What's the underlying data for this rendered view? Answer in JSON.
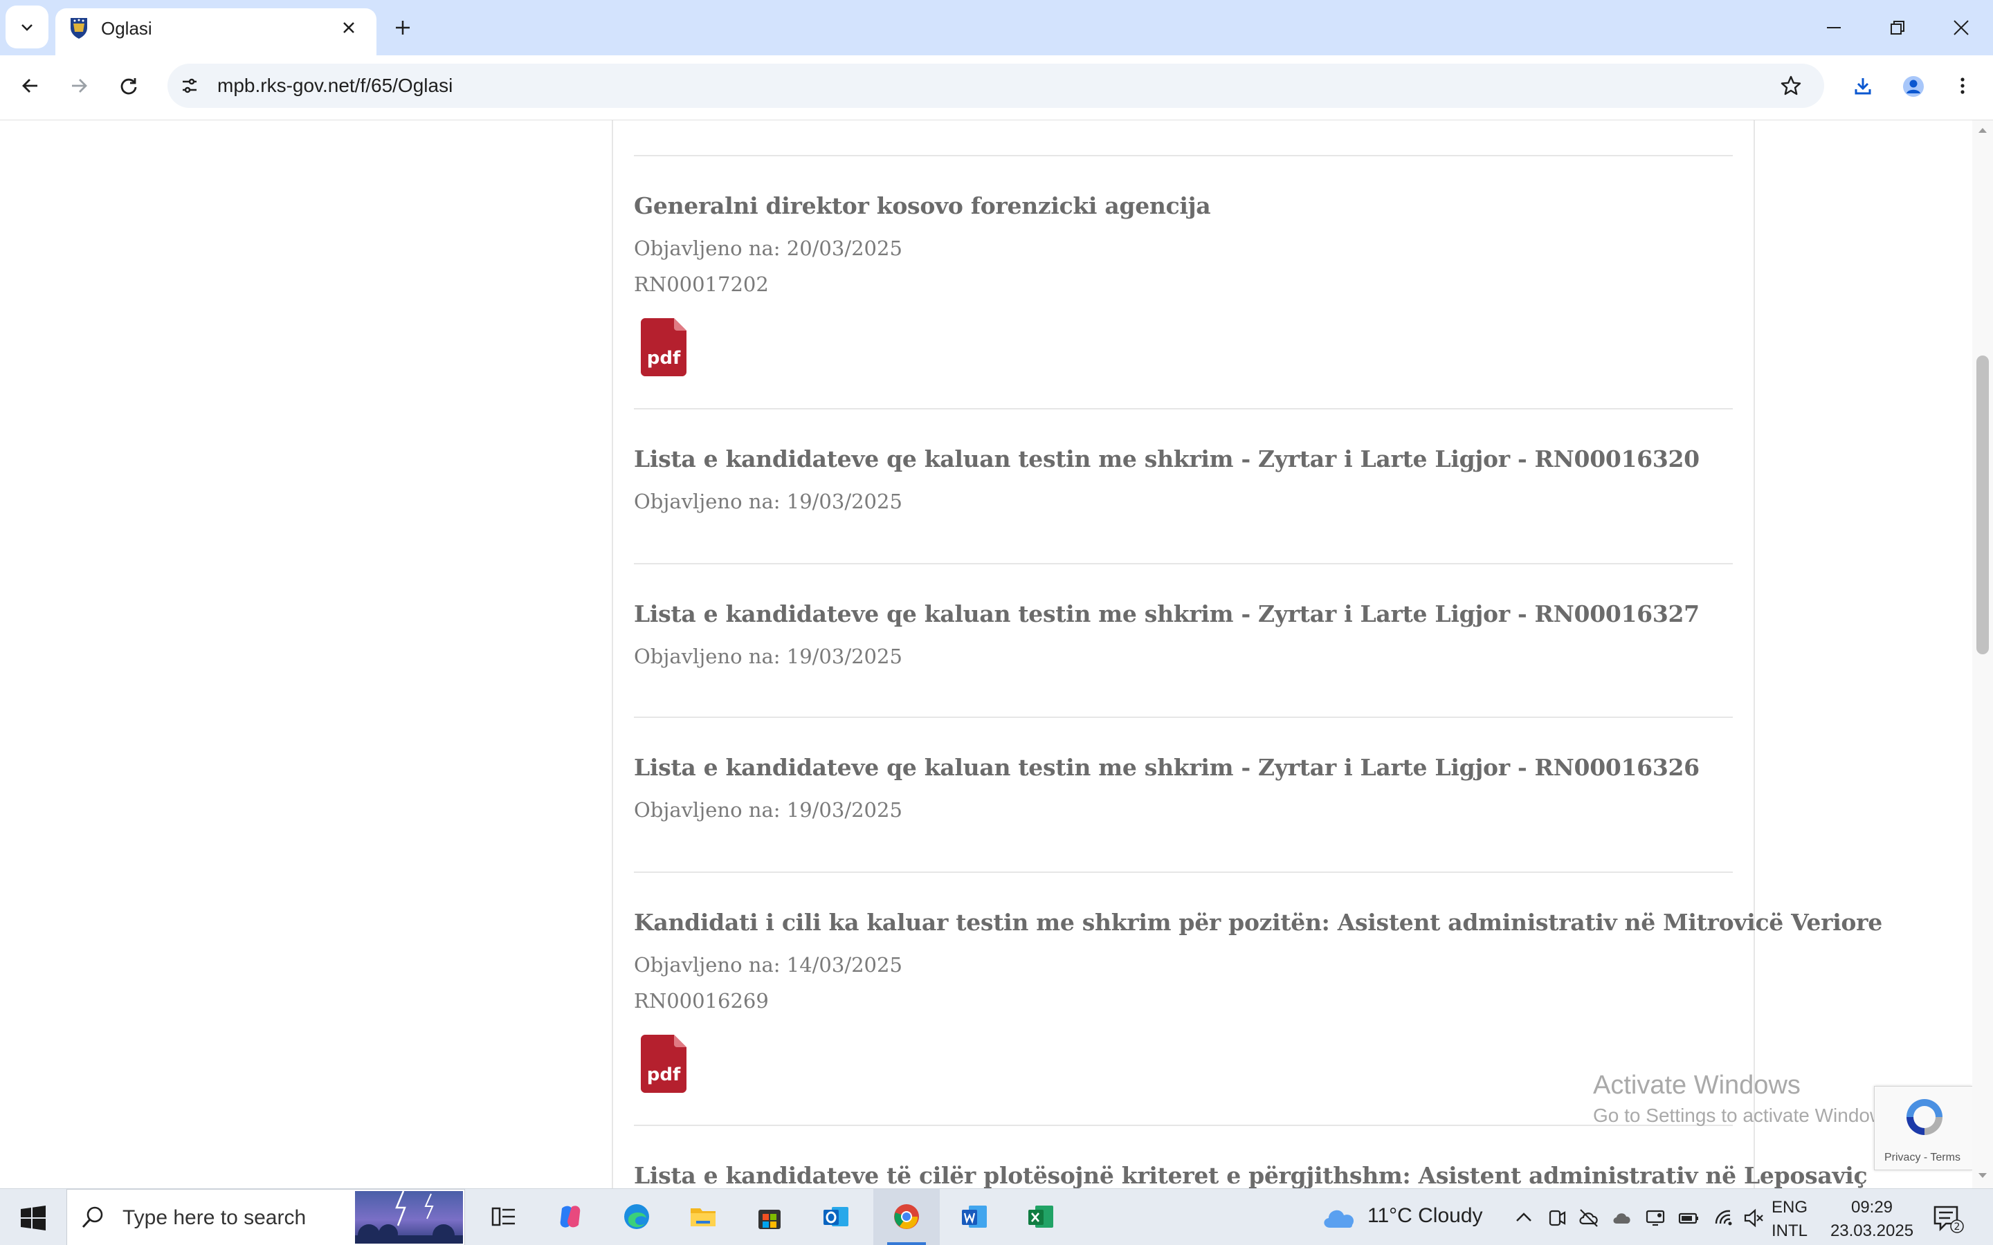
{
  "browser": {
    "tab_title": "Oglasi",
    "url": "mpb.rks-gov.net/f/65/Oglasi"
  },
  "items": [
    {
      "title": "Generalni direktor kosovo forenzicki agencija",
      "date_line": "Objavljeno na: 20/03/2025",
      "ref": "RN00017202",
      "has_pdf": true,
      "pdf_label": "pdf"
    },
    {
      "title": "Lista e kandidateve qe kaluan testin me shkrim - Zyrtar i Larte Ligjor - RN00016320",
      "date_line": "Objavljeno na: 19/03/2025",
      "has_pdf": false
    },
    {
      "title": "Lista e kandidateve qe kaluan testin me shkrim - Zyrtar i Larte Ligjor - RN00016327",
      "date_line": "Objavljeno na: 19/03/2025",
      "has_pdf": false
    },
    {
      "title": "Lista e kandidateve qe kaluan testin me shkrim - Zyrtar i Larte Ligjor - RN00016326",
      "date_line": "Objavljeno na: 19/03/2025",
      "has_pdf": false
    },
    {
      "title": "Kandidati i cili ka kaluar testin me shkrim për pozitën: Asistent administrativ në Mitrovicë Veriore",
      "date_line": "Objavljeno na: 14/03/2025",
      "ref": "RN00016269",
      "has_pdf": true,
      "pdf_label": "pdf"
    },
    {
      "title": "Lista e kandidateve të cilër plotësojnë kriteret e përgjithshm: Asistent administrativ në Leposaviç",
      "has_pdf": false
    }
  ],
  "watermark": {
    "line1": "Activate Windows",
    "line2": "Go to Settings to activate Windows."
  },
  "recaptcha": {
    "links": "Privacy - Terms"
  },
  "taskbar": {
    "search_placeholder": "Type here to search",
    "weather": "11°C  Cloudy",
    "lang_line1": "ENG",
    "lang_line2": "INTL",
    "time": "09:29",
    "date": "23.03.2025",
    "notification_count": "2",
    "apps": [
      "task-view",
      "copilot",
      "edge",
      "file-explorer",
      "microsoft-store",
      "outlook",
      "chrome",
      "word",
      "excel"
    ]
  },
  "colors": {
    "tabstrip": "#d3e3fd",
    "title_text": "#6b6b6b",
    "pdf_red": "#b5202e"
  }
}
